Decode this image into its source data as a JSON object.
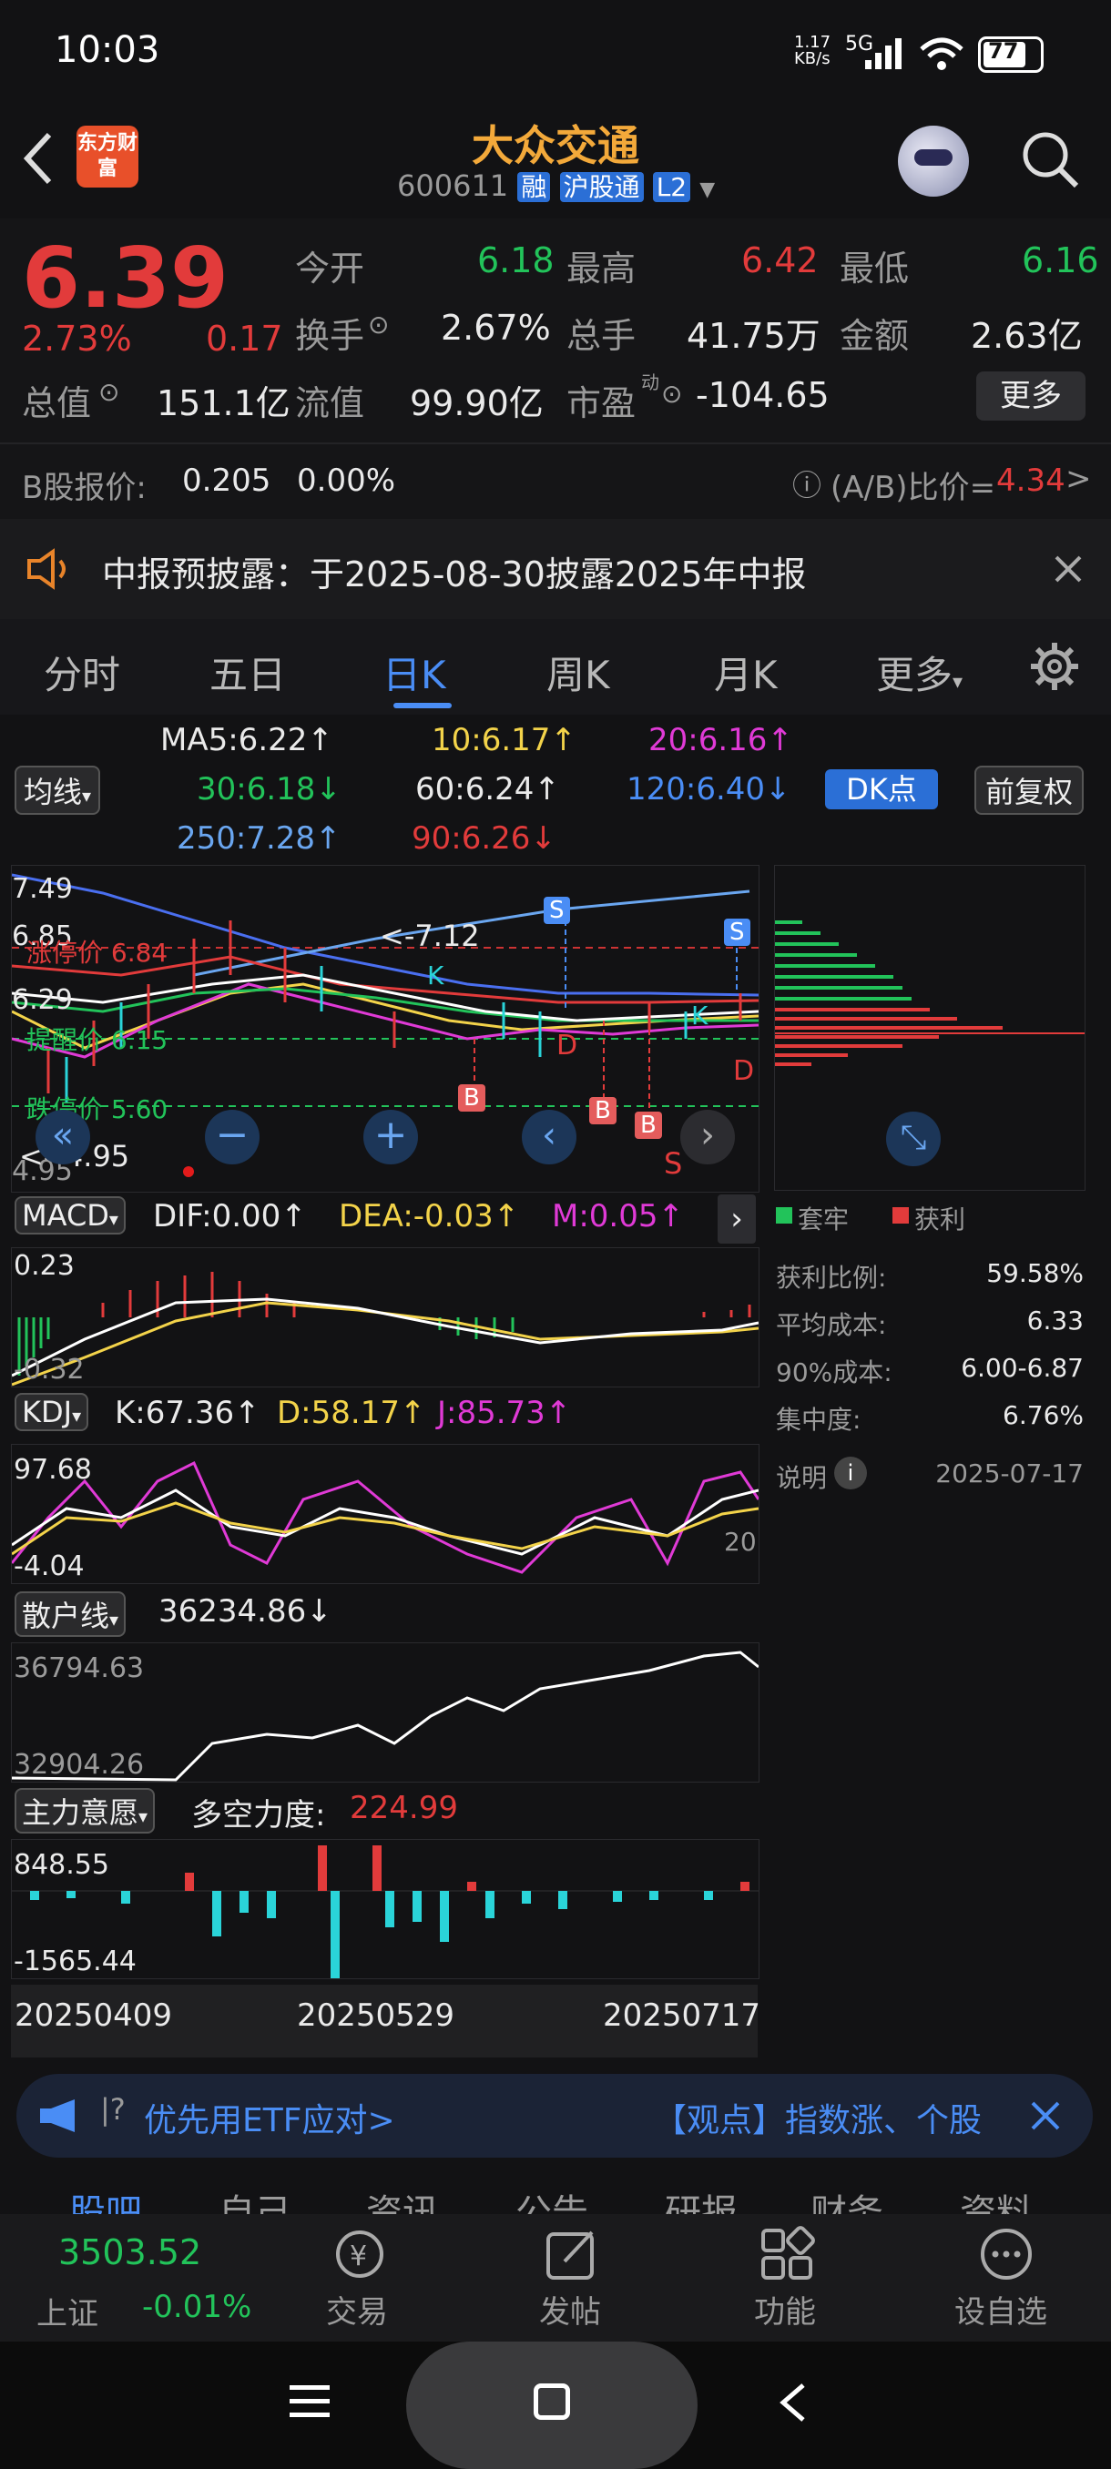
{
  "status_bar": {
    "time": "10:03",
    "net_speed": "1.17 KB/s",
    "net_type": "5G",
    "battery": "77"
  },
  "header": {
    "app_badge": "东方财富",
    "title": "大众交通",
    "code": "600611",
    "tag_margin": "融",
    "tag_connect": "沪股通",
    "tag_level": "L2"
  },
  "quote": {
    "price": "6.39",
    "change_pct": "2.73%",
    "change_abs": "0.17",
    "open_label": "今开",
    "open": "6.18",
    "high_label": "最高",
    "high": "6.42",
    "low_label": "最低",
    "low": "6.16",
    "turnover_label": "换手",
    "turnover": "2.67%",
    "volume_label": "总手",
    "volume": "41.75万",
    "amount_label": "金额",
    "amount": "2.63亿",
    "mktcap_label": "总值",
    "mktcap": "151.1亿",
    "float_label": "流值",
    "float": "99.90亿",
    "pe_label": "市盈",
    "pe_sup": "动",
    "pe": "-104.65",
    "more_label": "更多",
    "b_share_label": "B股报价:",
    "b_share_price": "0.205",
    "b_share_pct": "0.00%",
    "ab_ratio_label": "(A/B)比价=",
    "ab_ratio": "4.34"
  },
  "notice": {
    "text": "中报预披露：于2025-08-30披露2025年中报"
  },
  "tabs": [
    "分时",
    "五日",
    "日K",
    "周K",
    "月K",
    "更多"
  ],
  "active_tab": "日K",
  "ma_legend": {
    "ma_select": "均线",
    "ma5": "MA5:6.22↑",
    "ma10": "10:6.17↑",
    "ma20": "20:6.16↑",
    "ma30": "30:6.18↓",
    "ma60": "60:6.24↑",
    "ma120": "120:6.40↓",
    "ma250": "250:7.28↑",
    "ma90": "90:6.26↓",
    "dk_button": "DK点",
    "fq_button": "前复权"
  },
  "kline": {
    "y_top": "7.49",
    "y_bottom": "4.95",
    "y_mid1": "6.85",
    "y_mid2": "6.29",
    "limit_up": "涨停价 6.84",
    "alert": "提醒价 6.15",
    "limit_down": "跌停价 5.60",
    "high_marker": "<-7.12",
    "low_marker": "<--4.95",
    "markers_b": [
      "B",
      "B",
      "B"
    ],
    "markers_s": [
      "S",
      "S",
      "S"
    ],
    "marker_d": [
      "D",
      "D"
    ],
    "marker_k": [
      "K",
      "K"
    ]
  },
  "chips": {
    "legend_trap": "套牢",
    "legend_profit": "获利",
    "rows": [
      {
        "label": "获利比例:",
        "value": "59.58%"
      },
      {
        "label": "平均成本:",
        "value": "6.33"
      },
      {
        "label": "90%成本:",
        "value": "6.00-6.87"
      },
      {
        "label": "集中度:",
        "value": "6.76%"
      }
    ],
    "note_label": "说明",
    "date": "2025-07-17"
  },
  "macd": {
    "select": "MACD",
    "dif": "DIF:0.00↑",
    "dea": "DEA:-0.03↑",
    "m": "M:0.05↑",
    "y_top": "0.23",
    "y_bottom": "-0.32"
  },
  "kdj": {
    "select": "KDJ",
    "k": "K:67.36↑",
    "d": "D:58.17↑",
    "j": "J:85.73↑",
    "y_top": "97.68",
    "y_bottom": "-4.04",
    "y_right": "20"
  },
  "retail": {
    "select": "散户线",
    "value": "36234.86↓",
    "y_top": "36794.63",
    "y_bottom": "32904.26"
  },
  "main_force": {
    "select": "主力意愿",
    "label": "多空力度:",
    "value": "224.99",
    "y_top": "848.55",
    "y_bottom": "-1565.44"
  },
  "dates": [
    "20250409",
    "20250529",
    "20250717"
  ],
  "news": {
    "left": "优先用ETF应对>",
    "right": "【观点】指数涨、个股"
  },
  "subtabs": [
    "股吧",
    "自己",
    "资讯",
    "公告",
    "研报",
    "财务",
    "资料"
  ],
  "bottom_nav": {
    "index_value": "3503.52",
    "index_name": "上证",
    "index_change": "-0.01%",
    "items": [
      "交易",
      "发帖",
      "功能",
      "设自选"
    ]
  },
  "colors": {
    "up": "#e23b3b",
    "down": "#22c35a",
    "accent": "#4a8df5",
    "bg": "#121214"
  }
}
